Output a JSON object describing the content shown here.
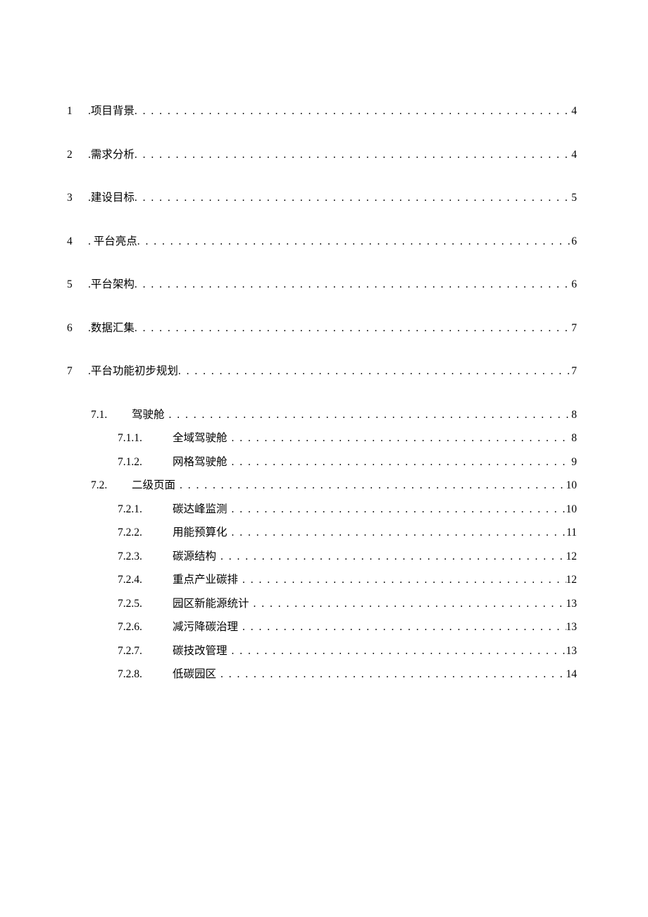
{
  "toc": {
    "entries": [
      {
        "level": 1,
        "num": "1",
        "title": ".项目背景",
        "page": "4"
      },
      {
        "level": 1,
        "num": "2",
        "title": ".需求分析",
        "page": "4"
      },
      {
        "level": 1,
        "num": "3",
        "title": ".建设目标",
        "page": "5"
      },
      {
        "level": 1,
        "num": "4",
        "title": ". 平台亮点",
        "page": "6"
      },
      {
        "level": 1,
        "num": "5",
        "title": ".平台架构",
        "page": "6"
      },
      {
        "level": 1,
        "num": "6",
        "title": ".数据汇集",
        "page": "7"
      },
      {
        "level": 1,
        "num": "7",
        "title": ".平台功能初步规划",
        "page": "7"
      },
      {
        "level": 2,
        "num": "7.1.",
        "title": "驾驶舱",
        "page": "8"
      },
      {
        "level": 3,
        "num": "7.1.1.",
        "title": "全域驾驶舱",
        "page": "8"
      },
      {
        "level": 3,
        "num": "7.1.2.",
        "title": "网格驾驶舱",
        "page": "9"
      },
      {
        "level": 2,
        "num": "7.2.",
        "title": "二级页面",
        "page": "10"
      },
      {
        "level": 3,
        "num": "7.2.1.",
        "title": "碳达峰监测",
        "page": "10"
      },
      {
        "level": 3,
        "num": "7.2.2.",
        "title": "用能预算化",
        "page": "11"
      },
      {
        "level": 3,
        "num": "7.2.3.",
        "title": "碳源结构",
        "page": "12"
      },
      {
        "level": 3,
        "num": "7.2.4.",
        "title": "重点产业碳排",
        "page": "12"
      },
      {
        "level": 3,
        "num": "7.2.5.",
        "title": "园区新能源统计",
        "page": "13"
      },
      {
        "level": 3,
        "num": "7.2.6.",
        "title": "减污降碳治理",
        "page": "13"
      },
      {
        "level": 3,
        "num": "7.2.7.",
        "title": "碳技改管理",
        "page": "13"
      },
      {
        "level": 3,
        "num": "7.2.8.",
        "title": "低碳园区",
        "page": "14"
      }
    ]
  }
}
